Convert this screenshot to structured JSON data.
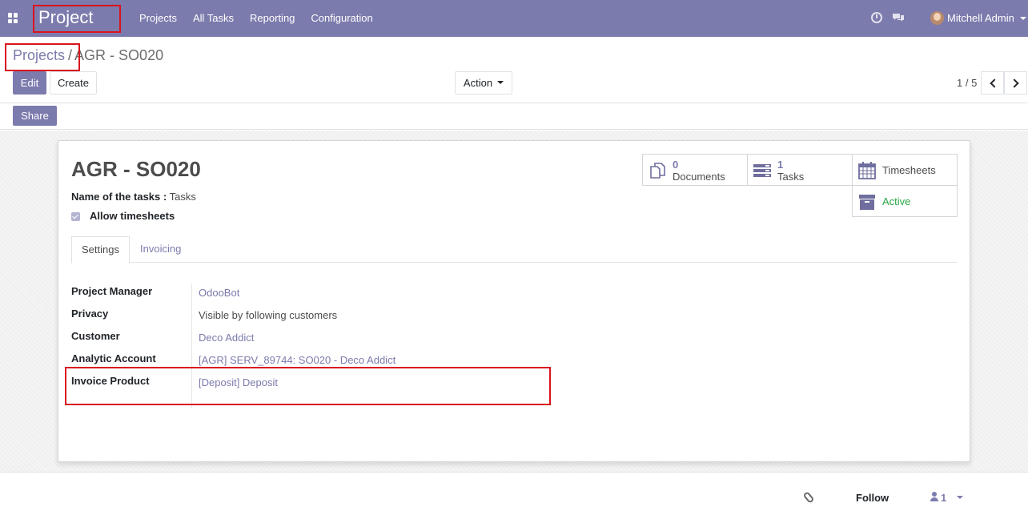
{
  "navbar": {
    "app_name": "Project",
    "menu": [
      "Projects",
      "All Tasks",
      "Reporting",
      "Configuration"
    ],
    "user_name": "Mitchell Admin",
    "icons": [
      "apps-icon",
      "clock-icon",
      "chat-icon"
    ]
  },
  "breadcrumb": {
    "parent": "Projects",
    "separator": "/",
    "current": "AGR - SO020"
  },
  "toolbar": {
    "edit_label": "Edit",
    "create_label": "Create",
    "action_label": "Action",
    "share_label": "Share",
    "pager_value": "1 / 5"
  },
  "record": {
    "title": "AGR - SO020",
    "tasks_name_label": "Name of the tasks :",
    "tasks_name_value": "Tasks",
    "allow_timesheets_label": "Allow timesheets",
    "allow_timesheets_checked": true
  },
  "smart_buttons": {
    "documents": {
      "count": "0",
      "label": "Documents"
    },
    "tasks": {
      "count": "1",
      "label": "Tasks"
    },
    "timesheets": {
      "label": "Timesheets"
    },
    "active": {
      "label": "Active"
    }
  },
  "tabs": [
    {
      "label": "Settings",
      "active": true
    },
    {
      "label": "Invoicing",
      "active": false
    }
  ],
  "settings": {
    "fields": [
      {
        "label": "Project Manager",
        "value": "OdooBot"
      },
      {
        "label": "Privacy",
        "value": "Visible by following customers"
      },
      {
        "label": "Customer",
        "value": "Deco Addict"
      },
      {
        "label": "Analytic Account",
        "value": "[AGR] SERV_89744: SO020 - Deco Addict"
      },
      {
        "label": "Invoice Product",
        "value": "[Deposit] Deposit"
      }
    ]
  },
  "chatter": {
    "follow_label": "Follow",
    "followers_count": "1"
  },
  "colors": {
    "brand": "#7c7bad",
    "active_status": "#28a745",
    "highlight": "#d9141e"
  }
}
